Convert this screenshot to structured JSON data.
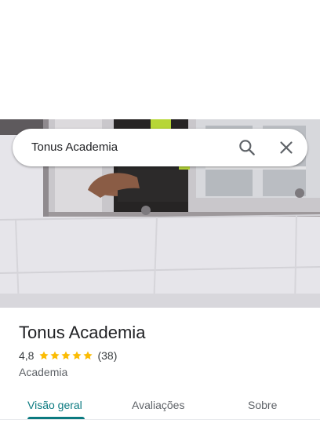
{
  "search": {
    "query": "Tonus Academia"
  },
  "place": {
    "title": "Tonus Academia",
    "rating": "4,8",
    "stars": 5,
    "review_count": "(38)",
    "category": "Academia"
  },
  "tabs": [
    {
      "label": "Visão geral",
      "active": true
    },
    {
      "label": "Avaliações",
      "active": false
    },
    {
      "label": "Sobre",
      "active": false
    }
  ],
  "colors": {
    "accent": "#0b7a80",
    "star": "#fbbc04"
  },
  "icons": {
    "search": "search-icon",
    "close": "close-icon",
    "star": "star-icon"
  }
}
